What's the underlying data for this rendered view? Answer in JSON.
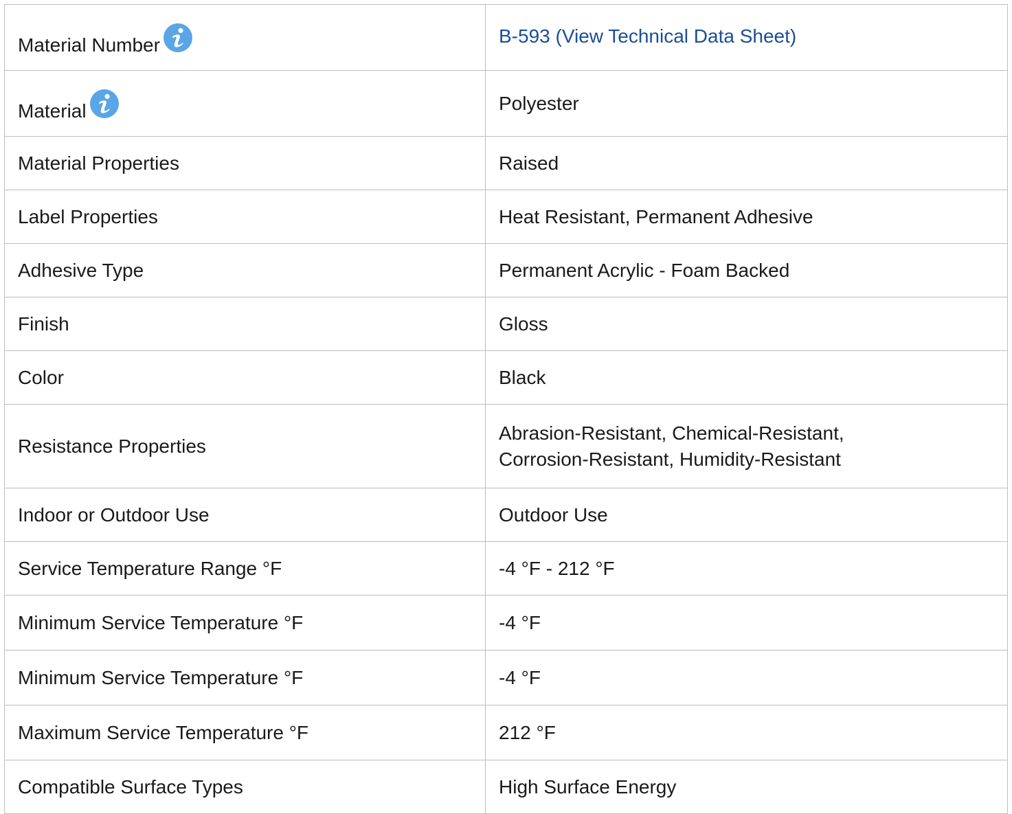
{
  "colors": {
    "link": "#1a4e96",
    "info_icon": "#5aa5e6",
    "border": "#bdbdbd"
  },
  "rows": [
    {
      "label": "Material Number",
      "value": "B-593 (View Technical Data Sheet)",
      "has_info": true,
      "is_link": true
    },
    {
      "label": "Material",
      "value": "Polyester",
      "has_info": true
    },
    {
      "label": "Material Properties",
      "value": "Raised"
    },
    {
      "label": "Label Properties",
      "value": "Heat Resistant, Permanent Adhesive"
    },
    {
      "label": "Adhesive Type",
      "value": "Permanent Acrylic - Foam Backed"
    },
    {
      "label": "Finish",
      "value": "Gloss"
    },
    {
      "label": "Color",
      "value": "Black"
    },
    {
      "label": "Resistance Properties",
      "value_line1": "Abrasion-Resistant, Chemical-Resistant,",
      "value_line2": "Corrosion-Resistant, Humidity-Resistant"
    },
    {
      "label": "Indoor or Outdoor Use",
      "value": "Outdoor Use"
    },
    {
      "label": "Service Temperature Range °F",
      "value": "-4 °F - 212 °F"
    },
    {
      "label": "Minimum Service Temperature °F",
      "value": "-4 °F"
    },
    {
      "label": "Minimum Service Temperature °F",
      "value": "-4 °F"
    },
    {
      "label": "Maximum Service Temperature °F",
      "value": "212 °F"
    },
    {
      "label": "Compatible Surface Types",
      "value": "High Surface Energy"
    }
  ]
}
